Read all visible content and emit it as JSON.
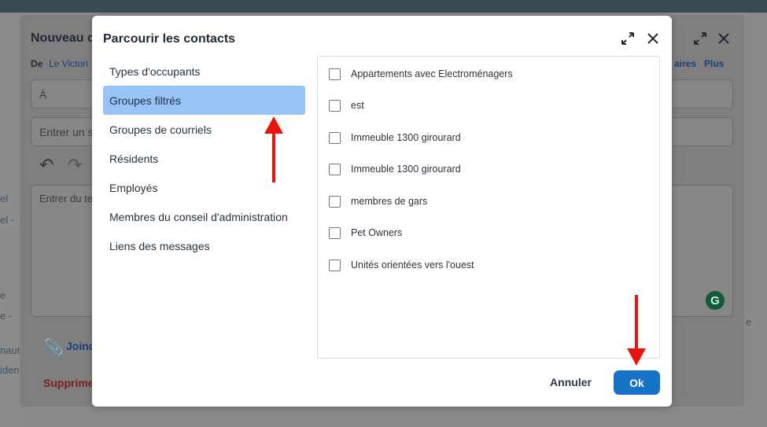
{
  "background": {
    "compose_title": "Nouveau c",
    "de_label": "De",
    "de_value": "Le Victori",
    "to_placeholder": "À",
    "subject_placeholder": "Entrer un s",
    "body_placeholder": "Entrer du te",
    "link_partial": "aires",
    "plus_label": "Plus",
    "join_label": "Joind",
    "delete_label": "Supprime",
    "grammarly_letter": "G",
    "left_fragments": [
      "el",
      "el -",
      "e",
      "e -",
      "naut",
      "iden"
    ],
    "right_fragment": "e"
  },
  "dialog": {
    "title": "Parcourir les contacts",
    "categories": [
      {
        "label": "Types d'occupants",
        "active": false
      },
      {
        "label": "Groupes filtrés",
        "active": true
      },
      {
        "label": "Groupes de courriels",
        "active": false
      },
      {
        "label": "Résidents",
        "active": false
      },
      {
        "label": "Employés",
        "active": false
      },
      {
        "label": "Membres du conseil d'administration",
        "active": false
      },
      {
        "label": "Liens des messages",
        "active": false
      }
    ],
    "groups": [
      {
        "label": "Appartements avec Electroménagers",
        "checked": false
      },
      {
        "label": "est",
        "checked": false
      },
      {
        "label": "Immeuble 1300 girourard",
        "checked": false
      },
      {
        "label": "Immeuble 1300 girourard",
        "checked": false
      },
      {
        "label": "membres de gars",
        "checked": false
      },
      {
        "label": "Pet Owners",
        "checked": false
      },
      {
        "label": "Unités orientées vers l'ouest",
        "checked": false
      }
    ],
    "cancel_label": "Annuler",
    "ok_label": "Ok"
  },
  "colors": {
    "accent": "#1572c6",
    "active_category": "#97c3f7",
    "annotation_arrow": "#e8150f"
  }
}
